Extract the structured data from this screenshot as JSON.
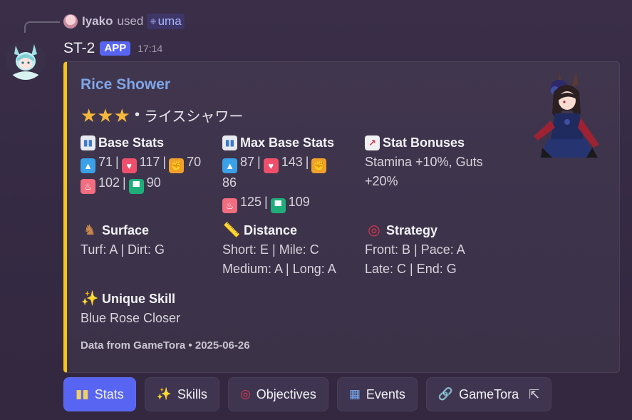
{
  "reply": {
    "user": "Iyako",
    "used": "used",
    "command": "uma"
  },
  "message": {
    "bot_name": "ST-2",
    "badge": "APP",
    "time": "17:14"
  },
  "embed": {
    "accent_color": "#f5c518",
    "title": "Rice Shower",
    "stars": "★★★",
    "bullet": "•",
    "japanese_name": "ライスシャワー",
    "fields": {
      "base_stats": {
        "name": "Base Stats",
        "speed": "71",
        "stamina": "117",
        "power": "70",
        "guts": "102",
        "wit": "90"
      },
      "max_base_stats": {
        "name": "Max Base Stats",
        "speed": "87",
        "stamina": "143",
        "power": "86",
        "guts": "125",
        "wit": "109"
      },
      "stat_bonuses": {
        "name": "Stat Bonuses",
        "line1": "Stamina +10%, Guts",
        "line2": "+20%"
      },
      "surface": {
        "name": "Surface",
        "value": "Turf: A | Dirt: G"
      },
      "distance": {
        "name": "Distance",
        "line1": "Short: E | Mile: C",
        "line2": "Medium: A | Long: A"
      },
      "strategy": {
        "name": "Strategy",
        "line1": "Front: B | Pace: A",
        "line2": "Late: C | End: G"
      },
      "unique_skill": {
        "name": "Unique Skill",
        "value": "Blue Rose Closer"
      }
    },
    "footer": "Data from GameTora • 2025-06-26"
  },
  "buttons": {
    "stats": "Stats",
    "skills": "Skills",
    "objectives": "Objectives",
    "events": "Events",
    "gametora": "GameTora"
  },
  "icons": {
    "command": "apps-icon",
    "chart": "bar-chart-icon",
    "trend": "chart-increasing-icon",
    "speed": "shoe-icon",
    "stamina": "heart-icon",
    "power": "flexed-arm-icon",
    "guts": "fire-icon",
    "wit": "graduation-cap-icon",
    "surface": "horse-racing-icon",
    "distance": "ruler-icon",
    "strategy": "target-icon",
    "unique_skill": "sparkles-icon",
    "external": "external-link-icon"
  }
}
